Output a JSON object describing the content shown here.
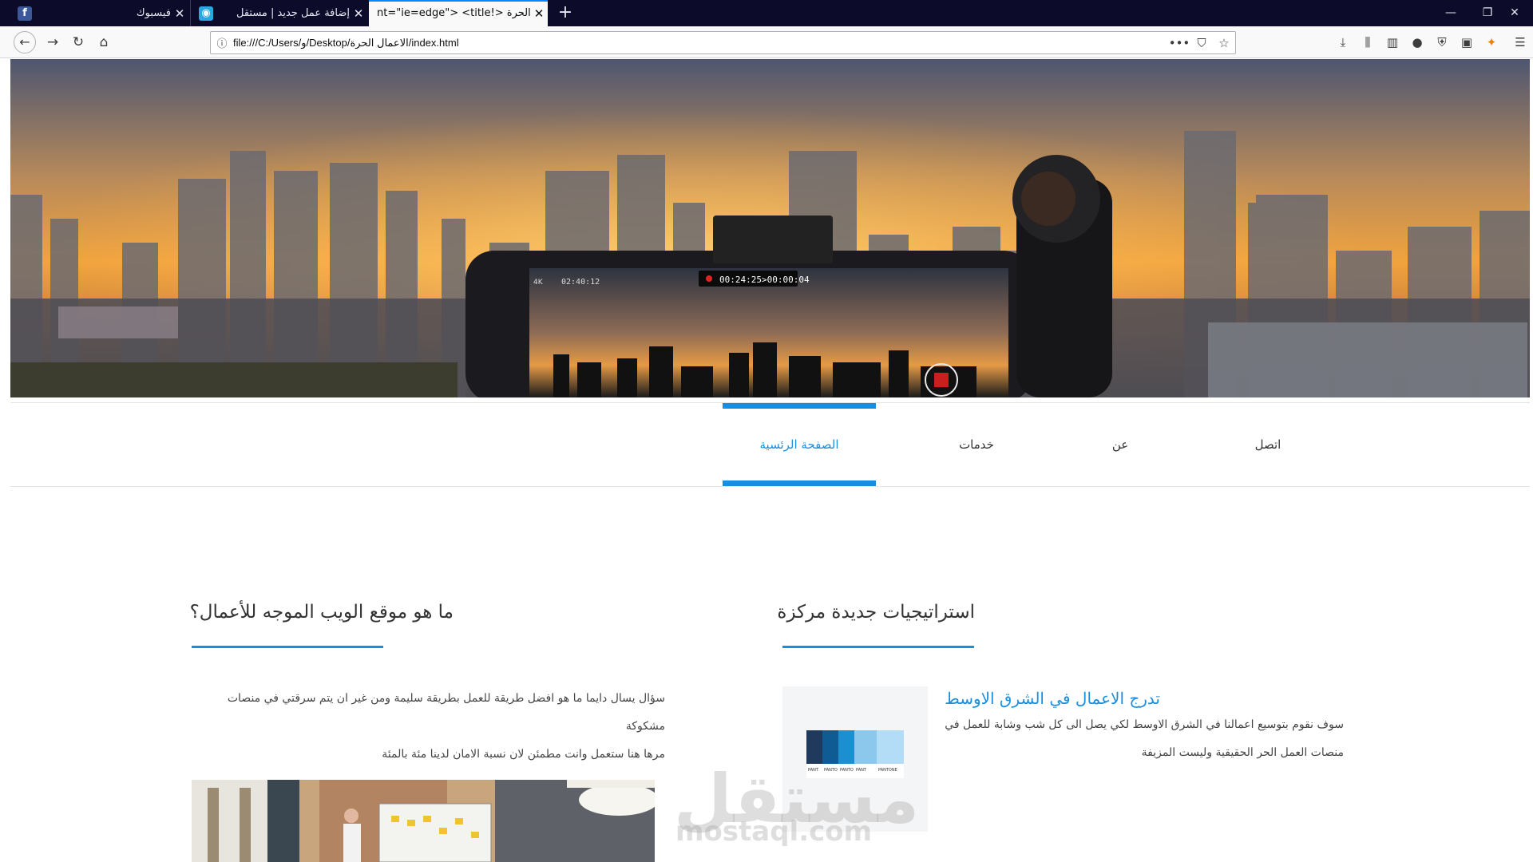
{
  "browser": {
    "tabs": [
      {
        "title": "فيسبوك",
        "favicon": "facebook-icon"
      },
      {
        "title": "إضافة عمل جديد | مستقل",
        "favicon": "mostaql-icon"
      },
      {
        "title": "nt=\"ie=edge\"> <title!> الاعمال الحرة",
        "favicon": "none"
      }
    ],
    "url": "file:///C:/Users/و/Desktop/الاعمال الحرة/index.html",
    "new_tab_symbol": "+",
    "window_controls": {
      "minimize": "—",
      "restore": "❐",
      "close": "✕"
    }
  },
  "hero": {
    "recording_time": "00:24:25>00:00:04",
    "phone_clock": "02:40:12",
    "phone_badge": "4K"
  },
  "nav": {
    "items": [
      {
        "label": "الصفحة الرئسية",
        "active": true
      },
      {
        "label": "خدمات",
        "active": false
      },
      {
        "label": "عن",
        "active": false
      },
      {
        "label": "اتصل",
        "active": false
      }
    ]
  },
  "left_section": {
    "heading": "ما هو موقع الويب الموجه للأعمال؟",
    "paragraph_line1": "سؤال يسال دايما ما هو افضل طريقة للعمل بطريقة سليمة ومن غير ان يتم سرقتي في منصات مشكوكة",
    "paragraph_line2": "مرها هنا ستعمل وانت مطمئن لان نسبة الامان لدينا مئة بالمئة"
  },
  "right_section": {
    "heading": "استراتيجيات جديدة مركزة",
    "article_title": "تدرج الاعمال في الشرق الاوسط",
    "article_line1": "سوف نقوم بتوسيع اعمالنا في الشرق الاوسط لكي يصل الى كل شب وشابة للعمل في",
    "article_line2": "منصات العمل الحر الحقيقية وليست المزيفة",
    "swatch_labels": [
      "PANT",
      "PANTO",
      "PANTO",
      "PANT",
      "PANTONE"
    ],
    "swatch_colors": [
      "#1f3a5c",
      "#0e5c93",
      "#1c8fd1",
      "#8cc7ec",
      "#b3dcf6"
    ]
  },
  "watermark": {
    "arabic": "مستقل",
    "latin": "mostaql.com"
  },
  "colors": {
    "accent": "#1a8ede",
    "tabbar": "#0c0c2a"
  }
}
